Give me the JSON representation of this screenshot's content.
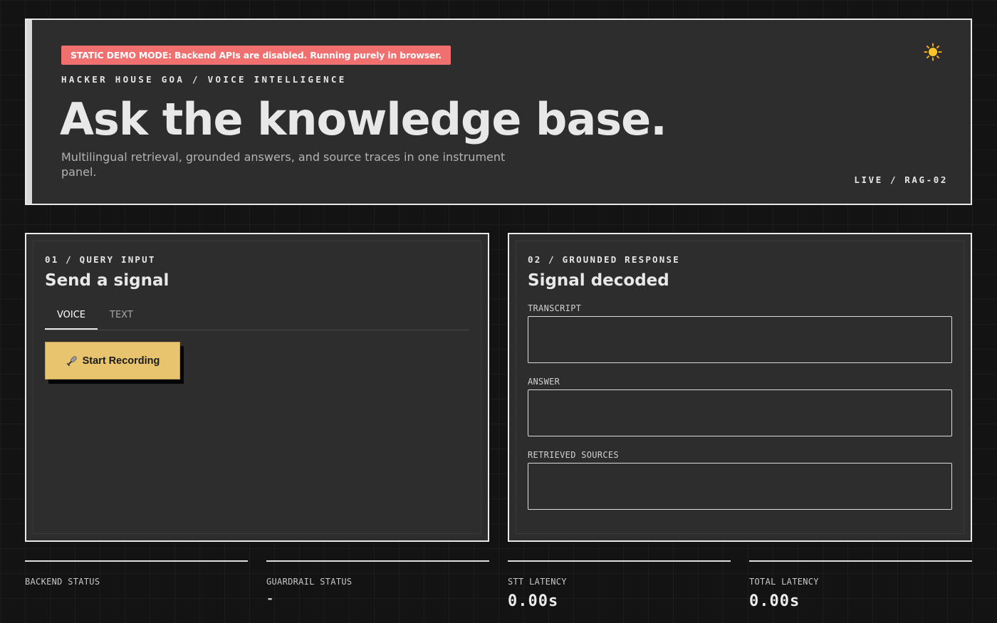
{
  "hero": {
    "banner": "STATIC DEMO MODE: Backend APIs are disabled. Running purely in browser.",
    "theme_toggle_icon": "sun-icon",
    "eyebrow": "HACKER HOUSE GOA / VOICE INTELLIGENCE",
    "title": "Ask the knowledge base.",
    "subtitle": "Multilingual retrieval, grounded answers, and source traces in one instrument panel.",
    "live_tag": "LIVE / RAG-02"
  },
  "query_panel": {
    "eyebrow": "01 / QUERY INPUT",
    "title": "Send a signal",
    "tabs": [
      {
        "label": "VOICE",
        "active": true
      },
      {
        "label": "TEXT",
        "active": false
      }
    ],
    "record_button": "Start Recording",
    "record_icon": "microphone-icon"
  },
  "response_panel": {
    "eyebrow": "02 / GROUNDED RESPONSE",
    "title": "Signal decoded",
    "transcript_label": "TRANSCRIPT",
    "transcript_value": "",
    "answer_label": "ANSWER",
    "answer_value": "",
    "sources_label": "RETRIEVED SOURCES",
    "sources_value": ""
  },
  "stats": [
    {
      "label": "BACKEND STATUS",
      "value": ""
    },
    {
      "label": "GUARDRAIL STATUS",
      "value": "-"
    },
    {
      "label": "STT LATENCY",
      "value": "0.00s"
    },
    {
      "label": "TOTAL LATENCY",
      "value": "0.00s"
    }
  ],
  "colors": {
    "background": "#131313",
    "panel": "#2d2d2d",
    "banner": "#f07070",
    "accent_button": "#e8c46e"
  }
}
